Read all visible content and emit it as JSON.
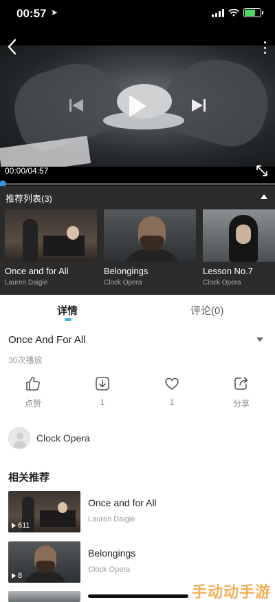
{
  "status_bar": {
    "time": "00:57"
  },
  "player": {
    "current_time": "00:00",
    "duration": "04:57",
    "time_display": "00:00/04:57",
    "progress": 0
  },
  "playlist": {
    "header": "推荐列表(3)",
    "items": [
      {
        "title": "Once and for All",
        "artist": "Lauren Daigle"
      },
      {
        "title": "Belongings",
        "artist": "Clock Opera"
      },
      {
        "title": "Lesson No.7",
        "artist": "Clock Opera"
      }
    ]
  },
  "tabs": {
    "details": "详情",
    "comments": "评论(0)"
  },
  "song": {
    "title": "Once And For All",
    "play_count": "30次播放"
  },
  "actions": {
    "like": "点赞",
    "download": "1",
    "favorite": "1",
    "share": "分享"
  },
  "author": {
    "name": "Clock Opera"
  },
  "related": {
    "heading": "相关推荐",
    "items": [
      {
        "title": "Once and for All",
        "artist": "Lauren Daigle",
        "plays": "611"
      },
      {
        "title": "Belongings",
        "artist": "Clock Opera",
        "plays": "8"
      }
    ]
  },
  "watermark": "手动动手游",
  "colors": {
    "accent": "#3ab0f0",
    "progress": "#3a8fe0",
    "watermark": "#f1a23a"
  }
}
